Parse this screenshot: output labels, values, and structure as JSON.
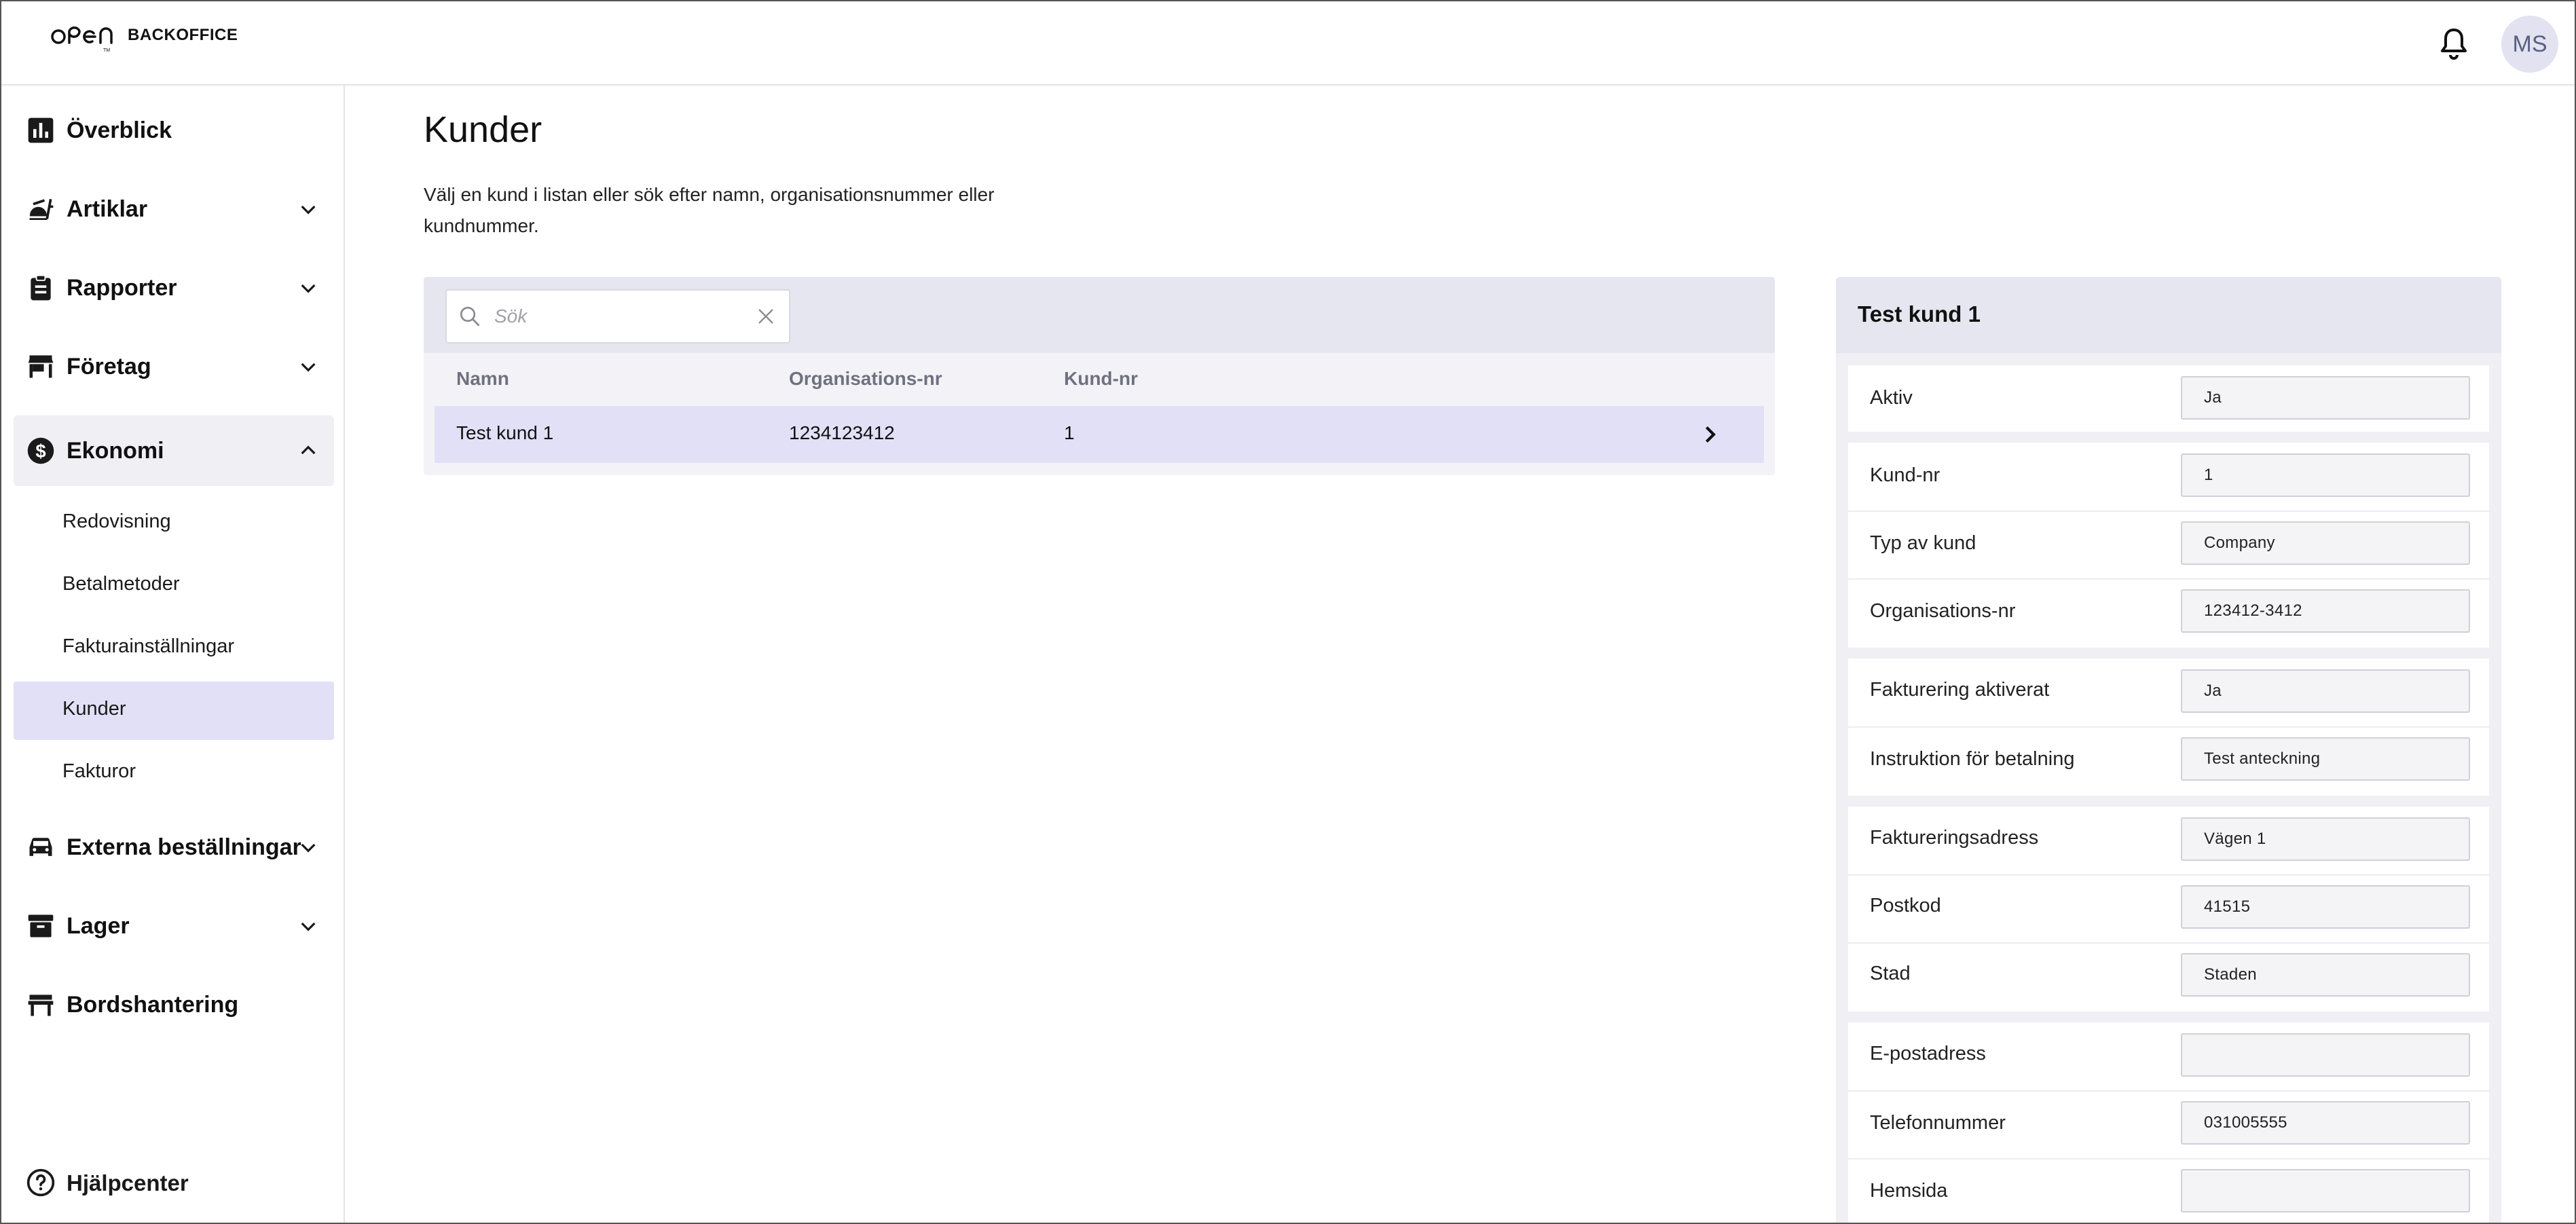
{
  "header": {
    "logo_text": "BACKOFFICE",
    "avatar_initials": "MS"
  },
  "sidebar": {
    "items": [
      {
        "label": "Överblick",
        "icon": "chart-icon"
      },
      {
        "label": "Artiklar",
        "icon": "food-icon"
      },
      {
        "label": "Rapporter",
        "icon": "clipboard-icon"
      },
      {
        "label": "Företag",
        "icon": "store-icon"
      },
      {
        "label": "Ekonomi",
        "icon": "dollar-icon"
      },
      {
        "label": "Externa beställningar",
        "icon": "car-icon"
      },
      {
        "label": "Lager",
        "icon": "archive-icon"
      },
      {
        "label": "Bordshantering",
        "icon": "table-icon"
      }
    ],
    "ekonomi_subitems": [
      "Redovisning",
      "Betalmetoder",
      "Fakturainställningar",
      "Kunder",
      "Fakturor"
    ],
    "help_label": "Hjälpcenter"
  },
  "main": {
    "title": "Kunder",
    "description": "Välj en kund i listan eller sök efter namn, organisationsnummer eller kundnummer.",
    "search_placeholder": "Sök",
    "columns": [
      "Namn",
      "Organisations-nr",
      "Kund-nr"
    ],
    "rows": [
      {
        "name": "Test kund 1",
        "org_nr": "1234123412",
        "kund_nr": "1"
      }
    ]
  },
  "detail": {
    "title": "Test kund 1",
    "fields": [
      {
        "label": "Aktiv",
        "value": "Ja"
      },
      {
        "label": "Kund-nr",
        "value": "1"
      },
      {
        "label": "Typ av kund",
        "value": "Company"
      },
      {
        "label": "Organisations-nr",
        "value": "123412-3412"
      },
      {
        "label": "Fakturering aktiverat",
        "value": "Ja"
      },
      {
        "label": "Instruktion för betalning",
        "value": "Test anteckning"
      },
      {
        "label": "Faktureringsadress",
        "value": "Vägen 1"
      },
      {
        "label": "Postkod",
        "value": "41515"
      },
      {
        "label": "Stad",
        "value": "Staden"
      },
      {
        "label": "E-postadress",
        "value": ""
      },
      {
        "label": "Telefonnummer",
        "value": "031005555"
      },
      {
        "label": "Hemsida",
        "value": ""
      }
    ]
  }
}
